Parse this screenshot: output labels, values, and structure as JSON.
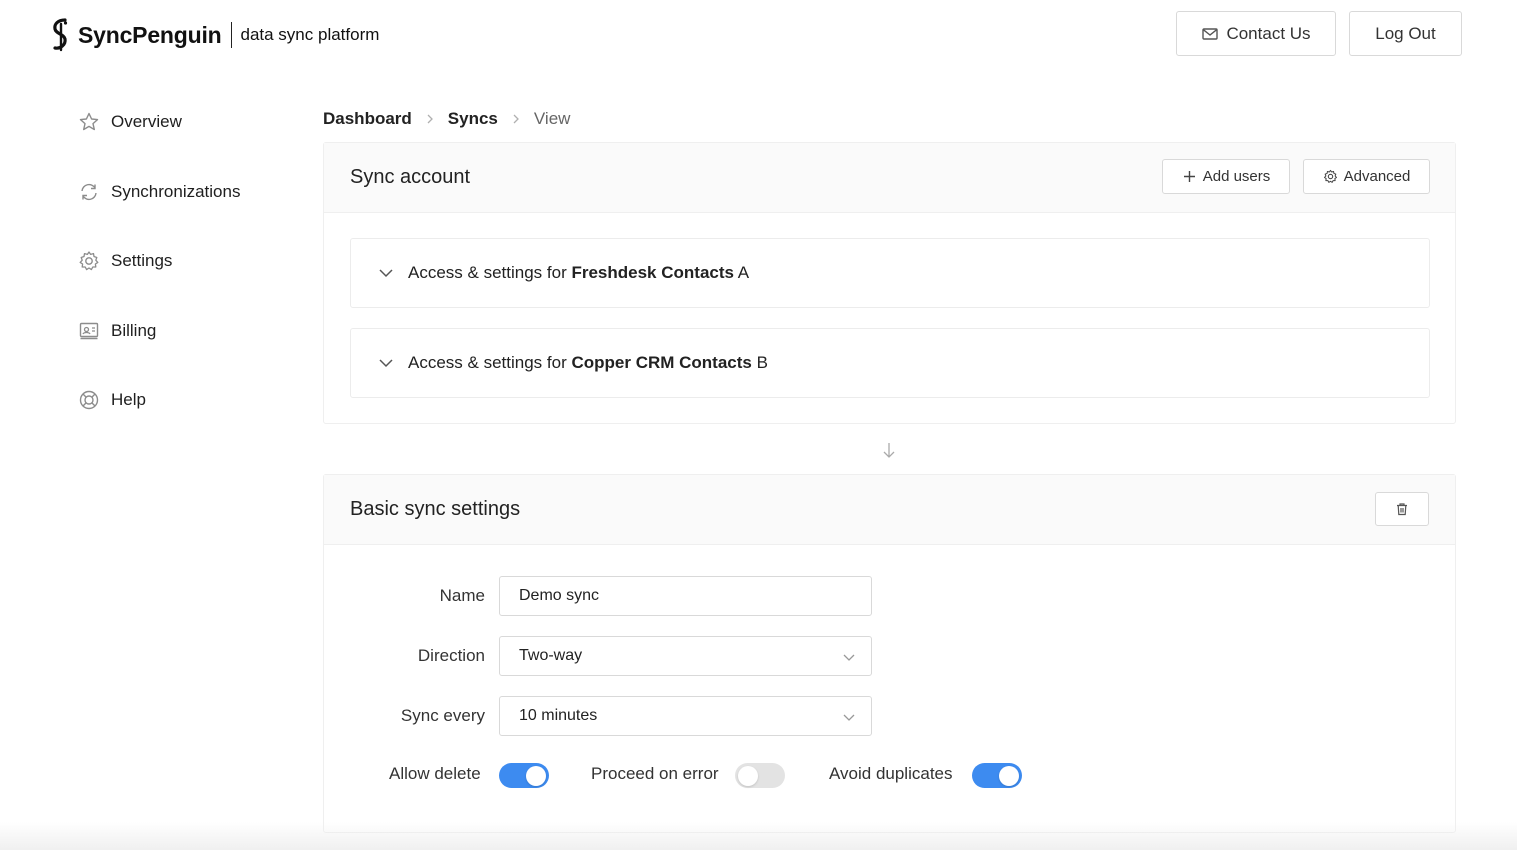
{
  "brand": {
    "name": "SyncPenguin",
    "tagline": "data sync platform",
    "icon": "penguin-s-logo"
  },
  "header": {
    "contact_label": "Contact Us",
    "contact_icon": "mail-icon",
    "logout_label": "Log Out"
  },
  "sidebar": {
    "items": [
      {
        "label": "Overview",
        "icon": "star-icon"
      },
      {
        "label": "Synchronizations",
        "icon": "sync-icon"
      },
      {
        "label": "Settings",
        "icon": "gear-icon"
      },
      {
        "label": "Billing",
        "icon": "billing-icon"
      },
      {
        "label": "Help",
        "icon": "lifebuoy-icon"
      }
    ]
  },
  "breadcrumb": {
    "items": [
      "Dashboard",
      "Syncs",
      "View"
    ]
  },
  "sync_account": {
    "title": "Sync account",
    "add_users_label": "Add users",
    "advanced_label": "Advanced",
    "panels": [
      {
        "prefix": "Access & settings for",
        "app": "Freshdesk Contacts",
        "suffix": "A"
      },
      {
        "prefix": "Access & settings for",
        "app": "Copper CRM Contacts",
        "suffix": "B"
      }
    ]
  },
  "basic_settings": {
    "title": "Basic sync settings",
    "name_label": "Name",
    "name_value": "Demo sync",
    "direction_label": "Direction",
    "direction_value": "Two-way",
    "sync_every_label": "Sync every",
    "sync_every_value": "10 minutes",
    "toggles": [
      {
        "label": "Allow delete",
        "on": true
      },
      {
        "label": "Proceed on error",
        "on": false
      },
      {
        "label": "Avoid duplicates",
        "on": true
      }
    ]
  },
  "colors": {
    "accent": "#3d8bf0",
    "toggle_off": "#e3e3e3",
    "card_header_bg": "#fafafa",
    "border": "#d9d9d9"
  }
}
